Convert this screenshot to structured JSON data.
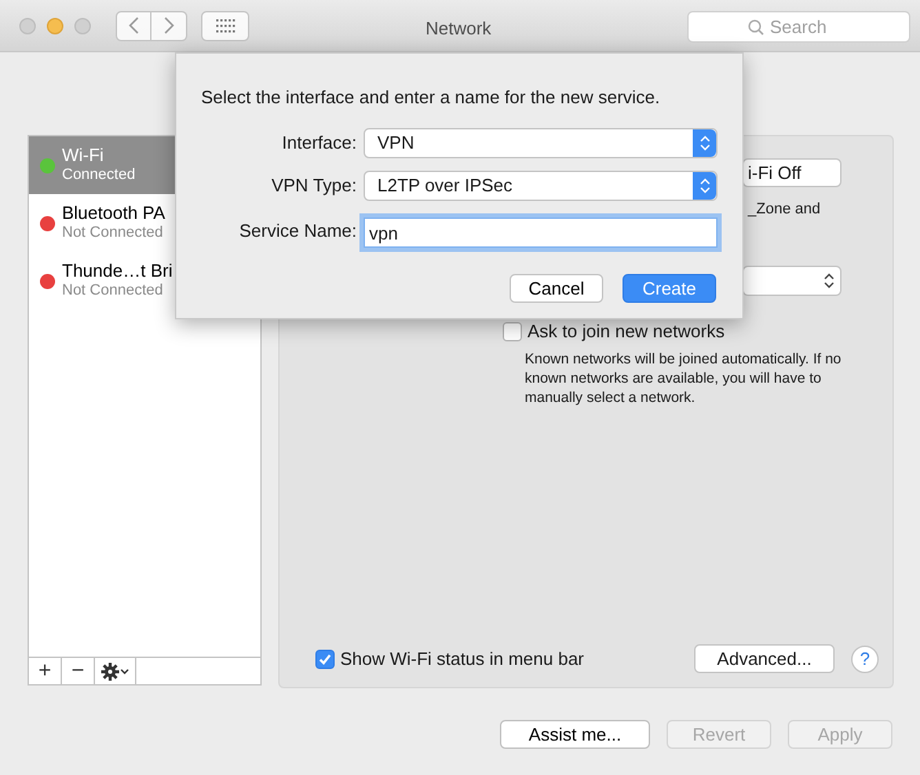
{
  "window": {
    "title": "Network",
    "search_placeholder": "Search"
  },
  "services": [
    {
      "name": "Wi-Fi",
      "status": "Connected",
      "selected": true,
      "color": "#5ac43c"
    },
    {
      "name": "Bluetooth PA",
      "status": "Not Connected",
      "selected": false,
      "color": "#e8403f"
    },
    {
      "name": "Thunde…t Bri",
      "status": "Not Connected",
      "selected": false,
      "color": "#e8403f"
    }
  ],
  "sidebar_tools": [
    "+",
    "−"
  ],
  "panel": {
    "wifi_button": "i-Fi Off",
    "network_text": "_Zone and",
    "ask_to_join": {
      "label": "Ask to join new networks",
      "checked": false
    },
    "ask_description": "Known networks will be joined automatically. If no known networks are available, you will have to manually select a network.",
    "show_status": {
      "label": "Show Wi-Fi status in menu bar",
      "checked": true
    },
    "advanced": "Advanced...",
    "help": "?"
  },
  "footer": [
    {
      "label": "Assist me...",
      "disabled": false
    },
    {
      "label": "Revert",
      "disabled": true
    },
    {
      "label": "Apply",
      "disabled": true
    }
  ],
  "dialog": {
    "prompt": "Select the interface and enter a name for the new service.",
    "fields": [
      {
        "kind": "popup",
        "label": "Interface:",
        "value": "VPN"
      },
      {
        "kind": "popup",
        "label": "VPN Type:",
        "value": "L2TP over IPSec"
      },
      {
        "kind": "text",
        "label": "Service Name:",
        "value": "vpn",
        "focused": true
      }
    ],
    "buttons": [
      {
        "label": "Cancel",
        "default": false
      },
      {
        "label": "Create",
        "default": true
      }
    ]
  }
}
